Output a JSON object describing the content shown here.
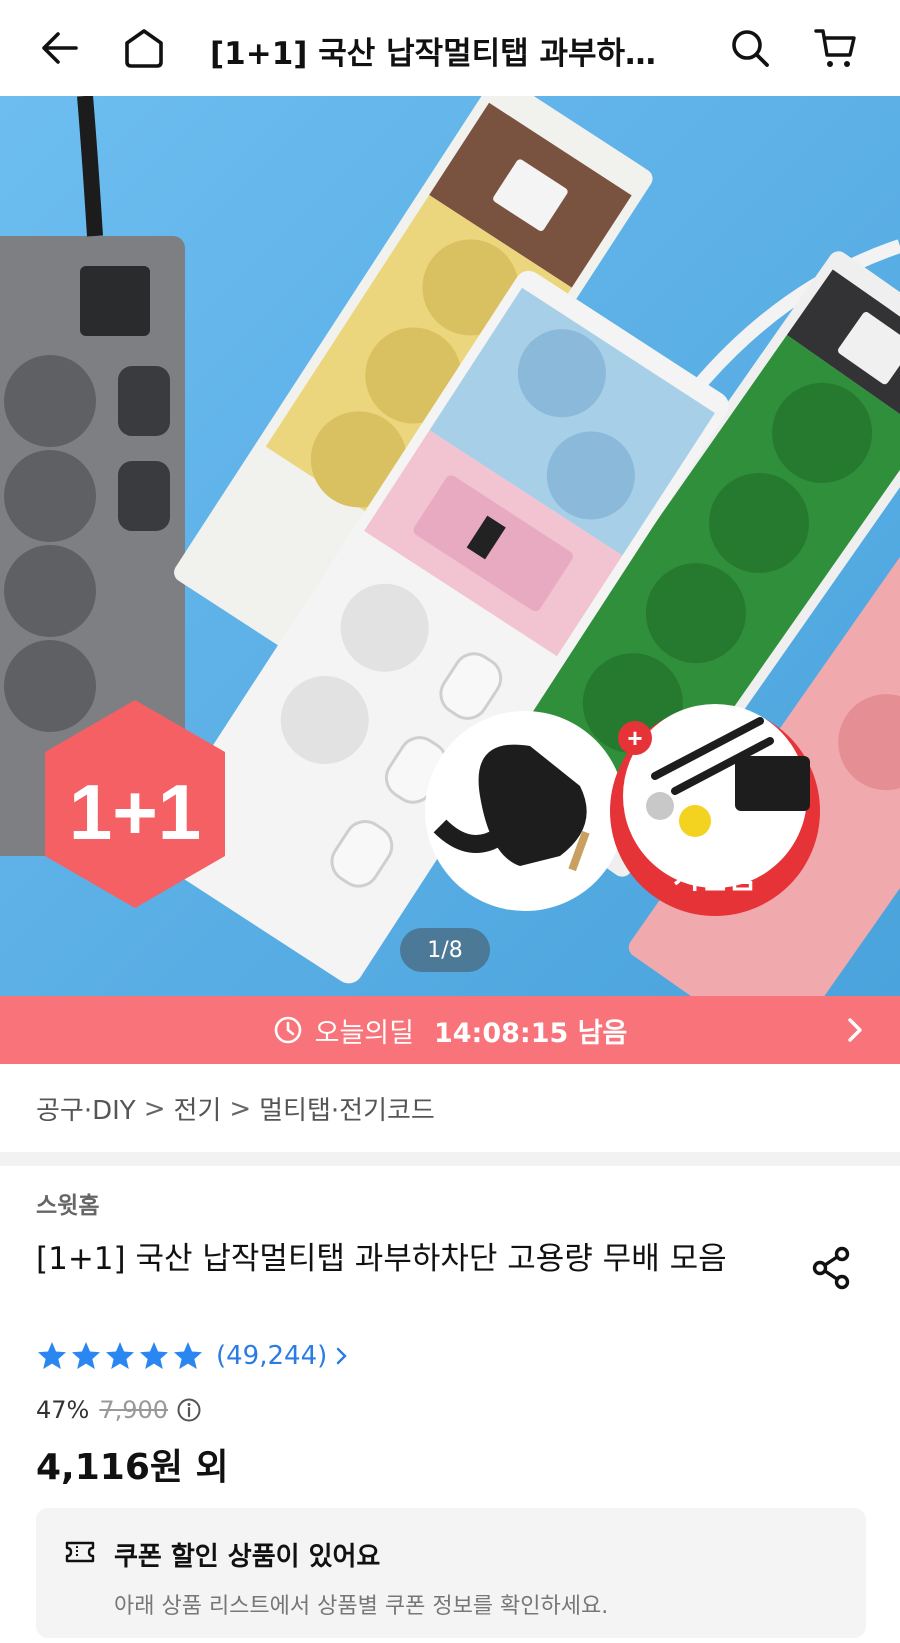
{
  "header": {
    "title": "[1+1] 국산 납작멀티탭 과부하…",
    "back_icon": "arrow-left-icon",
    "home_icon": "home-icon",
    "search_icon": "search-icon",
    "cart_icon": "cart-icon"
  },
  "hero": {
    "badge": "1+1",
    "gift_label": "사은품",
    "gift_plus": "+",
    "page_indicator": "1/8"
  },
  "deal_bar": {
    "label": "오늘의딜",
    "countdown": "14:08:15 남음",
    "color": "#f8747a"
  },
  "breadcrumb": {
    "items": [
      "공구·DIY",
      "전기",
      "멀티탭·전기코드"
    ],
    "separator": ">"
  },
  "product": {
    "seller": "스윗홈",
    "title": "[1+1] 국산 납작멀티탭 과부하차단 고용량 무배 모음",
    "rating_stars": 5,
    "review_count": "(49,244)",
    "discount_percent": "47%",
    "original_price": "7,900",
    "price": "4,116원 외",
    "star_color": "#2a86f0"
  },
  "coupon": {
    "title": "쿠폰 할인 상품이 있어요",
    "subtitle": "아래 상품 리스트에서 상품별 쿠폰 정보를 확인하세요."
  }
}
